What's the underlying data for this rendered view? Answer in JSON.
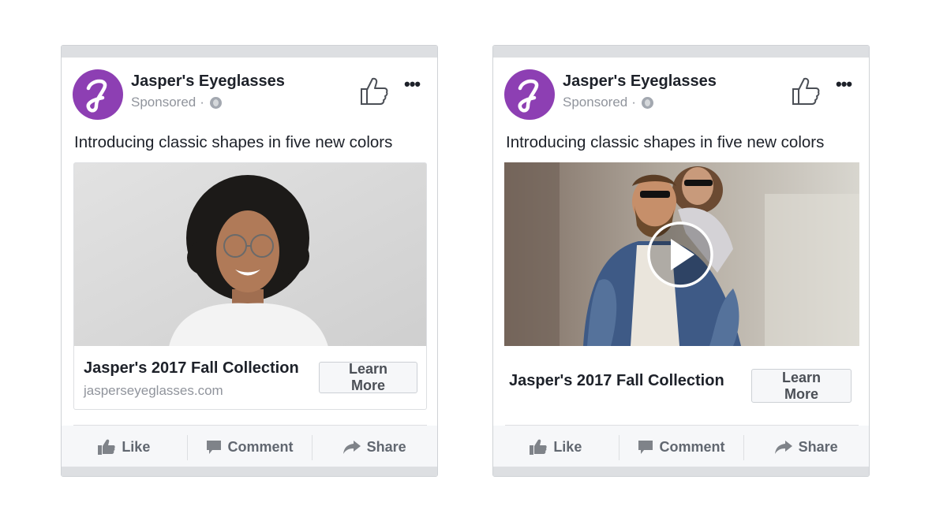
{
  "ads": [
    {
      "page_name": "Jasper's Eyeglasses",
      "sponsored": "Sponsored",
      "sponsored_separator": "·",
      "post_text": "Introducing classic shapes in five new colors",
      "media_type": "photo",
      "link_title": "Jasper's 2017 Fall Collection",
      "link_domain": "jasperseyeglasses.com",
      "cta": "Learn More",
      "actions": {
        "like": "Like",
        "comment": "Comment",
        "share": "Share"
      }
    },
    {
      "page_name": "Jasper's Eyeglasses",
      "sponsored": "Sponsored",
      "sponsored_separator": "·",
      "post_text": "Introducing classic shapes in five new colors",
      "media_type": "video",
      "link_title": "Jasper's 2017 Fall Collection",
      "cta": "Learn More",
      "actions": {
        "like": "Like",
        "comment": "Comment",
        "share": "Share"
      }
    }
  ],
  "icons": {
    "avatar_logo": "script-j-logo",
    "header_like": "thumbs-up-outline-icon",
    "more": "more-dots-icon",
    "audience": "globe-icon",
    "play": "play-icon",
    "like": "thumbs-up-icon",
    "comment": "comment-bubble-icon",
    "share": "share-arrow-icon"
  },
  "colors": {
    "brand_purple": "#8d3fb3",
    "action_gray": "#616770",
    "secondary_text": "#90949c",
    "card_border": "#dddfe2"
  }
}
